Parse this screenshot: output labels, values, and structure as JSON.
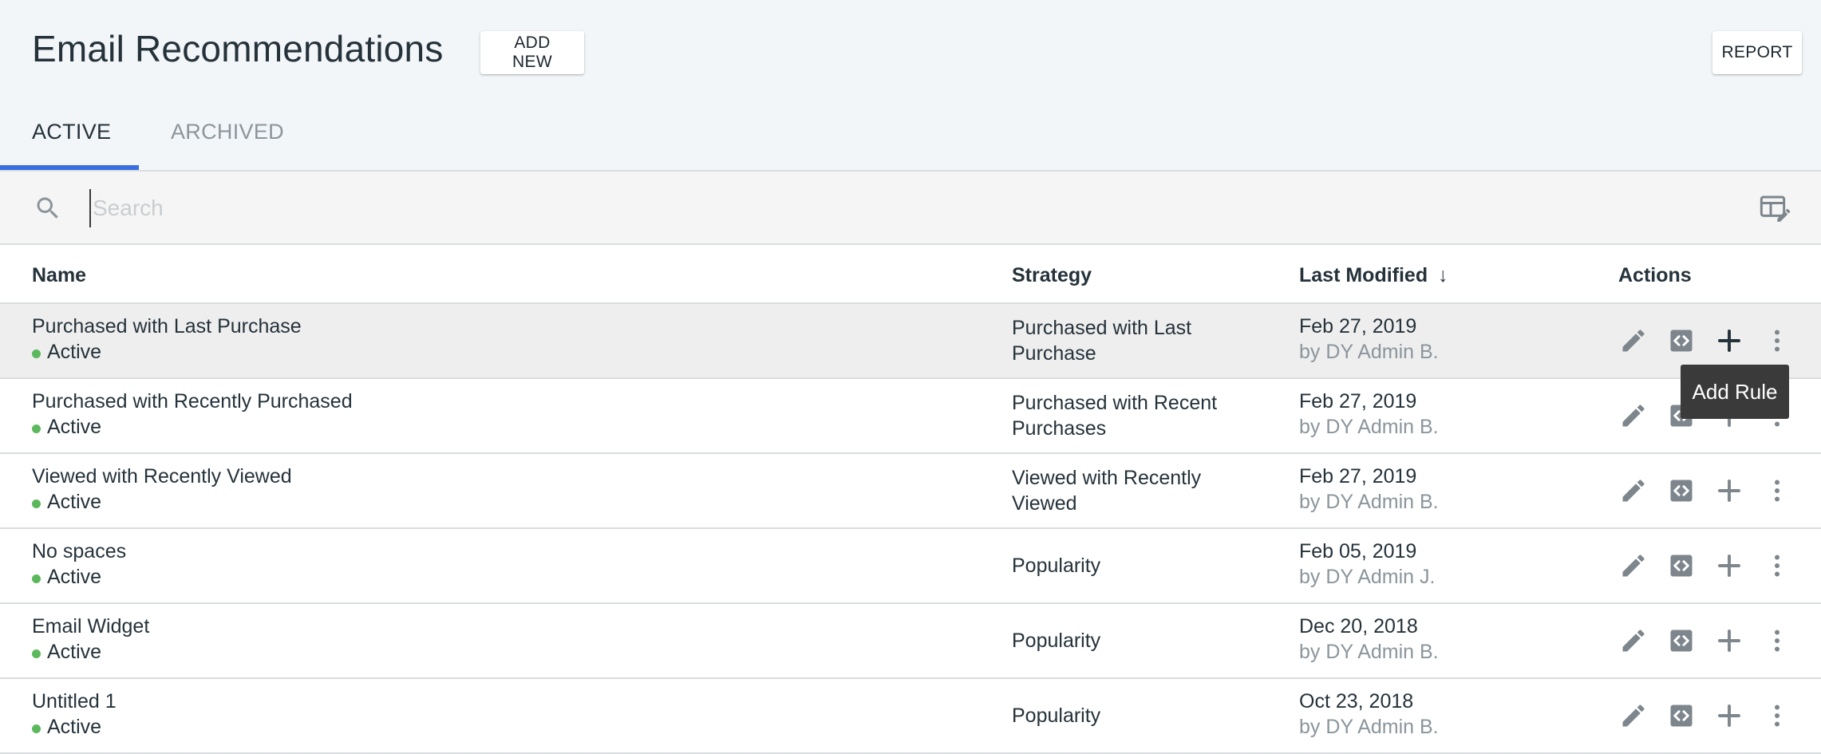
{
  "header": {
    "title": "Email Recommendations",
    "add_new_label": "ADD NEW",
    "report_label": "REPORT"
  },
  "tabs": [
    {
      "label": "ACTIVE",
      "active": true
    },
    {
      "label": "ARCHIVED",
      "active": false
    }
  ],
  "search": {
    "placeholder": "Search",
    "value": ""
  },
  "table": {
    "columns": {
      "name": "Name",
      "strategy": "Strategy",
      "last_modified": "Last Modified",
      "sort_indicator": "↓",
      "actions": "Actions"
    },
    "rows": [
      {
        "name": "Purchased with Last Purchase",
        "status": "Active",
        "strategy_line1": "Purchased with Last",
        "strategy_line2": "Purchase",
        "date": "Feb 27, 2019",
        "by": "by DY Admin B."
      },
      {
        "name": "Purchased with Recently Purchased",
        "status": "Active",
        "strategy_line1": "Purchased with Recent",
        "strategy_line2": "Purchases",
        "date": "Feb 27, 2019",
        "by": "by DY Admin B."
      },
      {
        "name": "Viewed with Recently Viewed",
        "status": "Active",
        "strategy_line1": "Viewed with Recently",
        "strategy_line2": "Viewed",
        "date": "Feb 27, 2019",
        "by": "by DY Admin B."
      },
      {
        "name": "No spaces",
        "status": "Active",
        "strategy_line1": "Popularity",
        "strategy_line2": "",
        "date": "Feb 05, 2019",
        "by": "by DY Admin J."
      },
      {
        "name": "Email Widget",
        "status": "Active",
        "strategy_line1": "Popularity",
        "strategy_line2": "",
        "date": "Dec 20, 2018",
        "by": "by DY Admin B."
      },
      {
        "name": "Untitled 1",
        "status": "Active",
        "strategy_line1": "Popularity",
        "strategy_line2": "",
        "date": "Oct 23, 2018",
        "by": "by DY Admin B."
      }
    ],
    "action_icons": [
      "pencil-icon",
      "code-icon",
      "plus-icon",
      "more-vertical-icon"
    ]
  },
  "tooltip": {
    "text": "Add Rule"
  },
  "colors": {
    "accent": "#3a6fe0",
    "status_active": "#5cb85c",
    "icon_gray": "#7d868c",
    "tooltip_bg": "#3a3a3a"
  }
}
